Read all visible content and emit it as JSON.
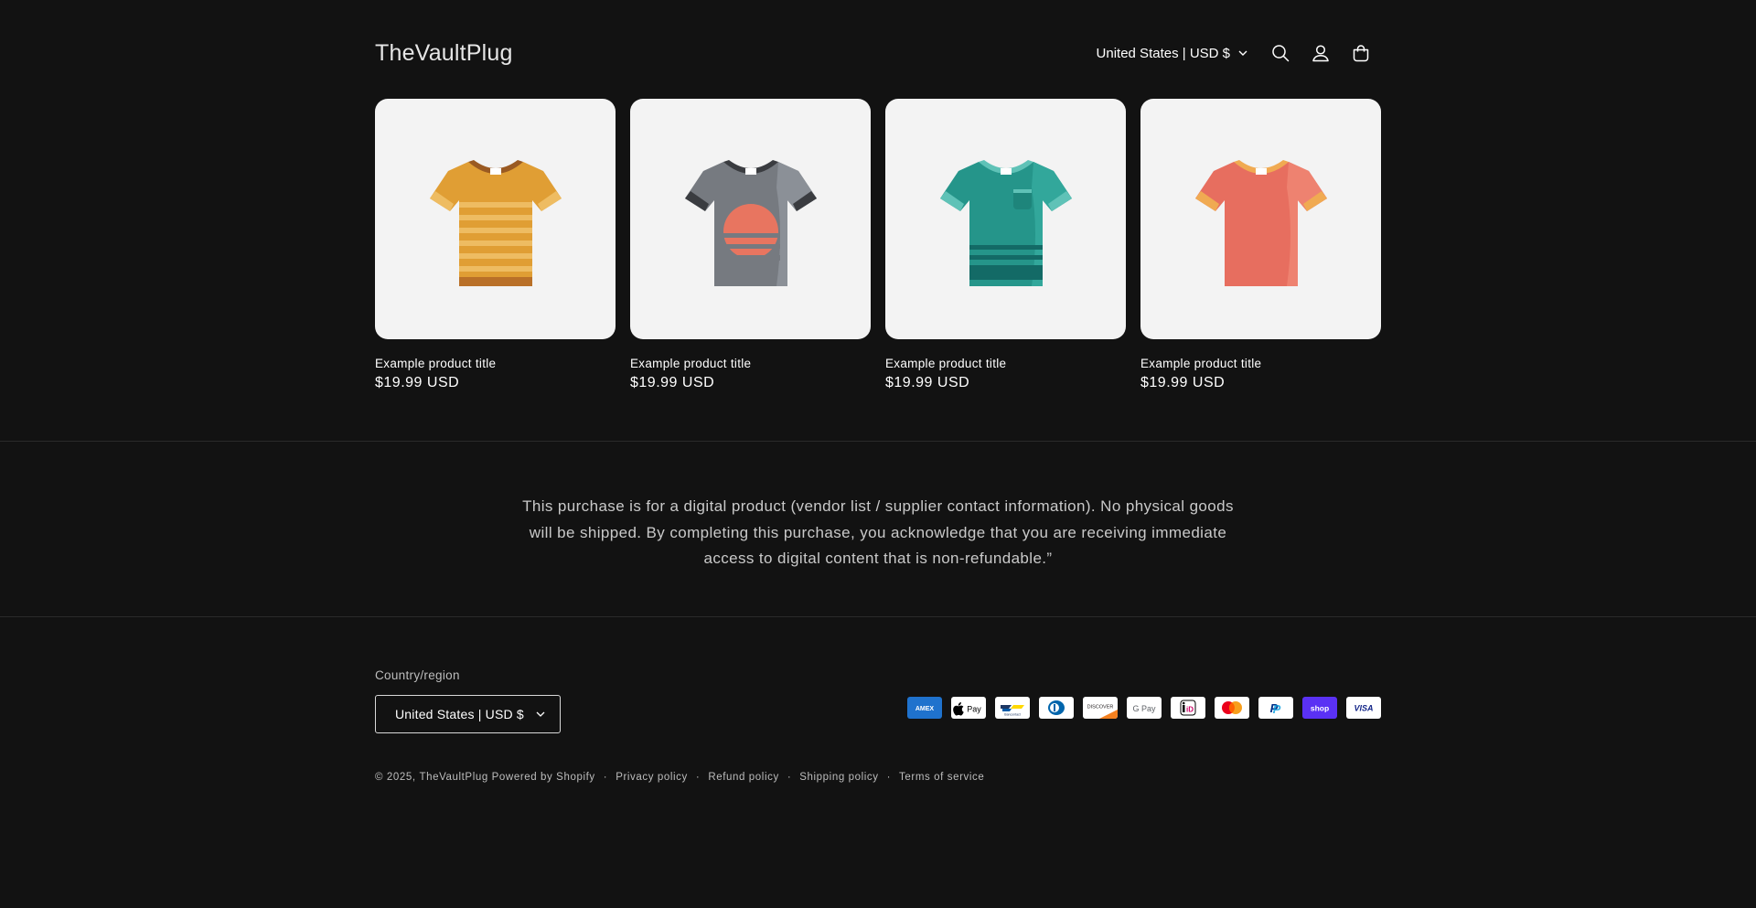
{
  "header": {
    "logo": "TheVaultPlug",
    "localization": "United States | USD $",
    "icons": [
      "search-icon",
      "account-icon",
      "cart-icon"
    ]
  },
  "products": [
    {
      "title": "Example product title",
      "price": "$19.99 USD",
      "image": "orange-striped-tshirt"
    },
    {
      "title": "Example product title",
      "price": "$19.99 USD",
      "image": "gray-sunset-tshirt"
    },
    {
      "title": "Example product title",
      "price": "$19.99 USD",
      "image": "teal-pocket-tshirt"
    },
    {
      "title": "Example product title",
      "price": "$19.99 USD",
      "image": "coral-ringer-tshirt"
    }
  ],
  "notice": "This purchase is for a digital product (vendor list / supplier contact information). No physical goods will be shipped. By completing this purchase, you acknowledge that you are receiving immediate access to digital content that is non-refundable.”",
  "footer": {
    "country_label": "Country/region",
    "country_value": "United States | USD $",
    "payments": [
      "American Express",
      "Apple Pay",
      "Bancontact",
      "Diners Club",
      "Discover",
      "Google Pay",
      "iDEAL",
      "Mastercard",
      "PayPal",
      "Shop Pay",
      "Visa"
    ],
    "payment_labels": {
      "amex": "AMEX",
      "applepay": "Pay",
      "bancontact": "Bancontact",
      "discover": "DISCOVER",
      "gpay": "G Pay",
      "ideal": "iD",
      "paypal": "P",
      "shoppay": "shop",
      "visa": "VISA"
    },
    "copyright": "© 2025,",
    "store_link": "TheVaultPlug",
    "powered": "Powered by Shopify",
    "policies": [
      "Privacy policy",
      "Refund policy",
      "Shipping policy",
      "Terms of service"
    ],
    "separator": "·"
  },
  "colors": {
    "background": "#121212",
    "card_background": "#f3f3f3",
    "text": "#ffffff"
  }
}
